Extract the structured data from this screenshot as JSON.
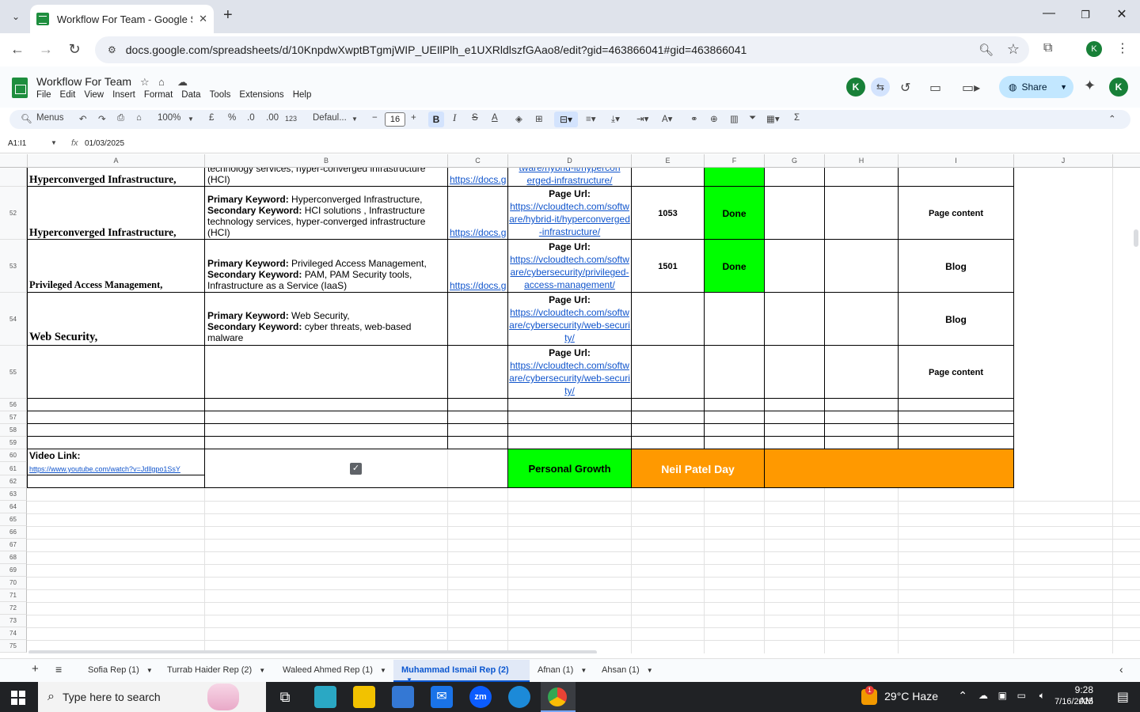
{
  "browser": {
    "tab_title": "Workflow For Team - Google Sh",
    "url": "docs.google.com/spreadsheets/d/10KnpdwXwptBTgmjWIP_UEIlPlh_e1UXRldlszfGAao8/edit?gid=463866041#gid=463866041",
    "profile_initial": "K"
  },
  "sheets": {
    "doc_title": "Workflow For Team",
    "menu": [
      "File",
      "Edit",
      "View",
      "Insert",
      "Format",
      "Data",
      "Tools",
      "Extensions",
      "Help"
    ],
    "share_label": "Share",
    "avatar_initial": "K",
    "toolbar": {
      "search": "Menus",
      "zoom": "100%",
      "currency": "£",
      "percent": "%",
      "dec_less": ".0",
      "dec_more": ".00",
      "number_format": "123",
      "font": "Defaul...",
      "font_size": "16"
    },
    "namebox": "A1:I1",
    "formula_value": "01/03/2025",
    "columns": [
      "A",
      "B",
      "C",
      "D",
      "E",
      "F",
      "G",
      "H",
      "I",
      "J"
    ]
  },
  "rows": {
    "numbers": [
      "52",
      "53",
      "54",
      "55",
      "56",
      "57",
      "58",
      "59",
      "60",
      "61",
      "62",
      "63",
      "64",
      "65",
      "66",
      "67",
      "68",
      "69",
      "70",
      "71",
      "72",
      "73",
      "74",
      "75"
    ]
  },
  "cells": {
    "r51_a": "Hyperconverged Infrastructure,",
    "r51_b": "technology services, hyper-converged infrastructure (HCI)",
    "r51_c": "https://docs.g",
    "r51_d": "erged-infrastructure/",
    "r51_d_top": "tware/hybrid-it/hypercon",
    "r52_a": "Hyperconverged Infrastructure,",
    "r52_b_pk_label": "Primary Keyword:",
    "r52_b_pk": " Hyperconverged Infrastructure,",
    "r52_b_sk_label": "Secondary Keyword:",
    "r52_b_sk": " HCI solutions , Infrastructure technology services, hyper-converged infrastructure (HCI)",
    "r52_c": "https://docs.g",
    "r52_d_label": "Page Url:",
    "r52_d_url": "https://vcloudtech.com/software/hybrid-it/hyperconverged-infrastructure/",
    "r52_e": "1053",
    "r52_f": "Done",
    "r52_i": "Page content",
    "r53_a": "Privileged Access Management,",
    "r53_b_pk_label": "Primary Keyword:",
    "r53_b_pk": " Privileged Access Management,",
    "r53_b_sk_label": "Secondary Keyword:",
    "r53_b_sk": " PAM, PAM Security tools, Infrastructure as a Service (IaaS)",
    "r53_c": "https://docs.g",
    "r53_d_label": "Page Url:",
    "r53_d_url": "https://vcloudtech.com/software/cybersecurity/privileged-access-management/",
    "r53_e": "1501",
    "r53_f": "Done",
    "r53_i": "Blog",
    "r54_a": "Web Security,",
    "r54_b_pk_label": "Primary Keyword:",
    "r54_b_pk": " Web Security,",
    "r54_b_sk_label": "Secondary Keyword:",
    "r54_b_sk": " cyber threats, web-based malware",
    "r54_d_label": "Page Url:",
    "r54_d_url": "https://vcloudtech.com/software/cybersecurity/web-security/",
    "r54_i": "Blog",
    "r55_d_label": "Page Url:",
    "r55_d_url": "https://vcloudtech.com/software/cybersecurity/web-security/",
    "r55_i": "Page content",
    "r60_a": "Video Link:",
    "r61_a": "https://www.youtube.com/watch?v=Jdllgpo1SsY",
    "r60_d": "Personal Growth",
    "r60_e": "Neil Patel Day"
  },
  "sheet_tabs": [
    "Sofia Rep (1)",
    "Turrab Haider Rep (2)",
    "Waleed Ahmed Rep (1)",
    "Muhammad Ismail Rep (2)",
    "Afnan (1)",
    "Ahsan (1)"
  ],
  "taskbar": {
    "search_placeholder": "Type here to search",
    "weather": "29°C  Haze",
    "time": "9:28 AM",
    "date": "7/16/2025",
    "notification_count": "1"
  },
  "colors": {
    "done_green": "#00ff00",
    "orange": "#ff9900",
    "link_blue": "#1155cc"
  }
}
